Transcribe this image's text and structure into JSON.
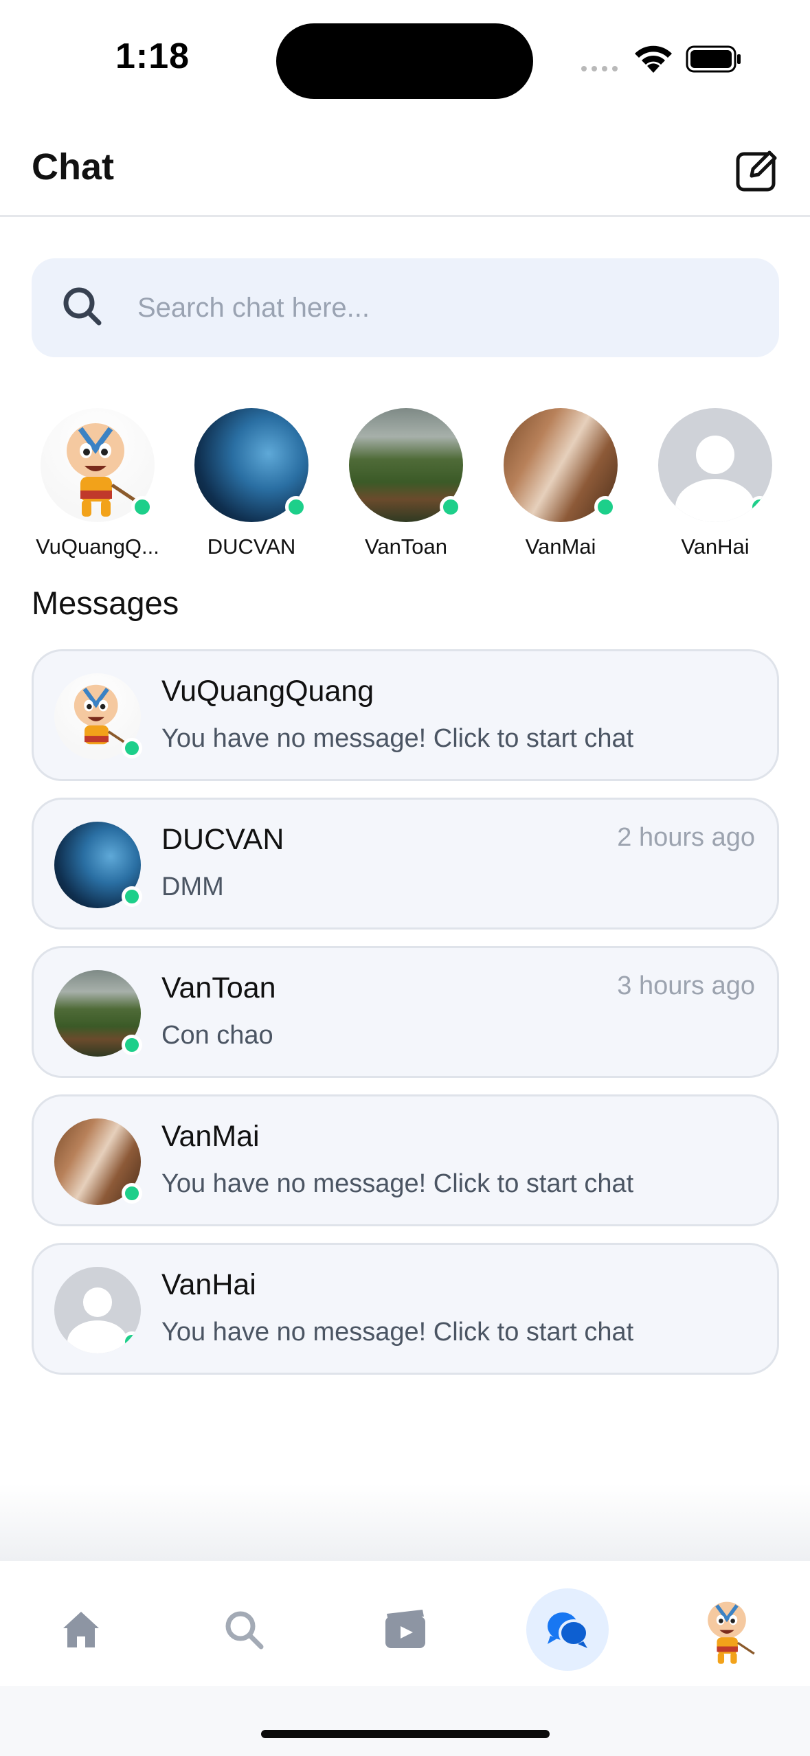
{
  "status_bar": {
    "time": "1:18"
  },
  "header": {
    "title": "Chat",
    "compose_icon": "compose-icon"
  },
  "search": {
    "placeholder": "Search chat here..."
  },
  "stories": [
    {
      "name": "VuQuangQ...",
      "online": true
    },
    {
      "name": "DUCVAN",
      "online": true
    },
    {
      "name": "VanToan",
      "online": true
    },
    {
      "name": "VanMai",
      "online": true
    },
    {
      "name": "VanHai",
      "online": true
    }
  ],
  "messages": {
    "title": "Messages",
    "items": [
      {
        "name": "VuQuangQuang",
        "preview": "You have no message! Click to start chat",
        "time": ""
      },
      {
        "name": "DUCVAN",
        "preview": "DMM",
        "time": "2 hours ago"
      },
      {
        "name": "VanToan",
        "preview": "Con chao",
        "time": "3 hours ago"
      },
      {
        "name": "VanMai",
        "preview": "You have no message! Click to start chat",
        "time": ""
      },
      {
        "name": "VanHai",
        "preview": "You have no message! Click to start chat",
        "time": ""
      }
    ]
  },
  "tabbar": {
    "items": [
      "home-icon",
      "search-icon",
      "video-icon",
      "chat-icon",
      "profile-avatar"
    ],
    "active": "chat-icon"
  },
  "colors": {
    "online": "#1dcf8a",
    "accent": "#1877f2",
    "card_bg": "#f4f6fb",
    "search_bg": "#edf2fb"
  }
}
